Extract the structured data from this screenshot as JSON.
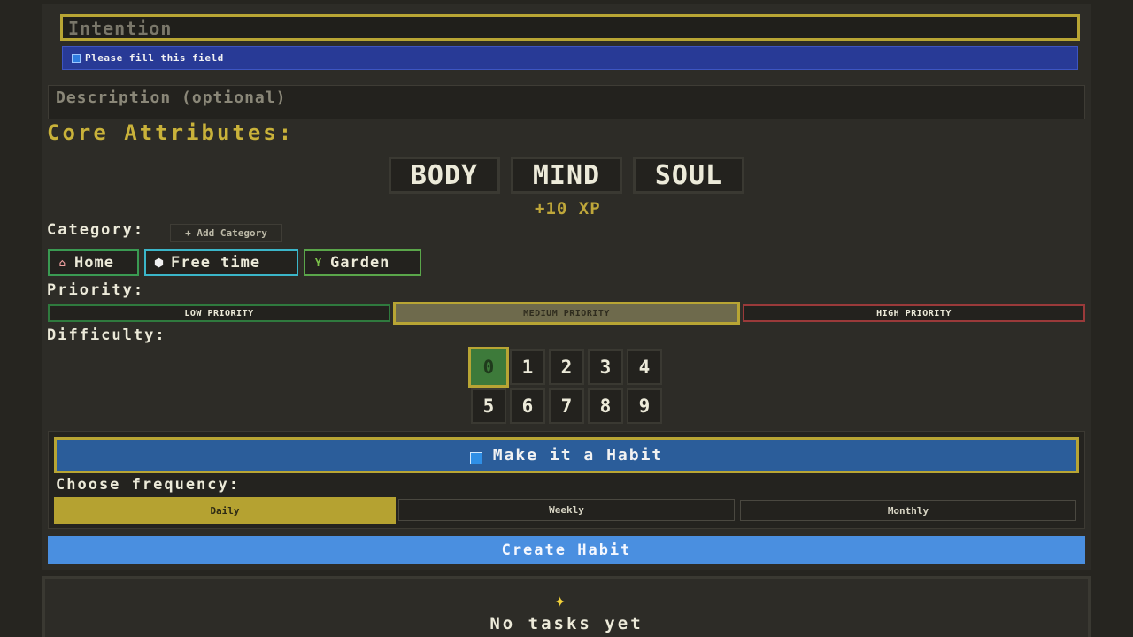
{
  "form": {
    "intention_placeholder": "Intention",
    "validation_message": "Please fill this field",
    "description_placeholder": "Description (optional)"
  },
  "core_attributes": {
    "title": "Core Attributes:",
    "items": [
      {
        "label": "BODY"
      },
      {
        "label": "MIND"
      },
      {
        "label": "SOUL"
      }
    ],
    "xp_reward": "+10 XP"
  },
  "category": {
    "title": "Category:",
    "add_label": "+ Add Category",
    "items": [
      {
        "label": "Home",
        "icon": "house-icon",
        "color": "#3a9a52"
      },
      {
        "label": "Free time",
        "icon": "dice-icon",
        "color": "#3bb6c9"
      },
      {
        "label": "Garden",
        "icon": "sprout-icon",
        "color": "#5aa64a"
      }
    ]
  },
  "priority": {
    "title": "Priority:",
    "options": [
      {
        "label": "LOW PRIORITY",
        "color": "#2f7a3e"
      },
      {
        "label": "MEDIUM PRIORITY",
        "color": "#b8a534",
        "selected": true
      },
      {
        "label": "HIGH PRIORITY",
        "color": "#9a3a3a"
      }
    ]
  },
  "difficulty": {
    "title": "Difficulty:",
    "selected": "0",
    "levels": [
      "0",
      "1",
      "2",
      "3",
      "4",
      "5",
      "6",
      "7",
      "8",
      "9"
    ]
  },
  "habit": {
    "button_label": "Make it a Habit",
    "frequency_title": "Choose frequency:",
    "frequencies": [
      "Daily",
      "Weekly",
      "Monthly"
    ],
    "selected_frequency": "Daily"
  },
  "submit_label": "Create Habit",
  "task_list": {
    "empty_icon": "sparkles-icon",
    "empty_message": "No tasks yet"
  },
  "colors": {
    "accent_gold": "#b8a534",
    "habit_blue": "#2b5d9a",
    "create_blue": "#4a8fe0",
    "tooltip_blue": "#283a96"
  }
}
